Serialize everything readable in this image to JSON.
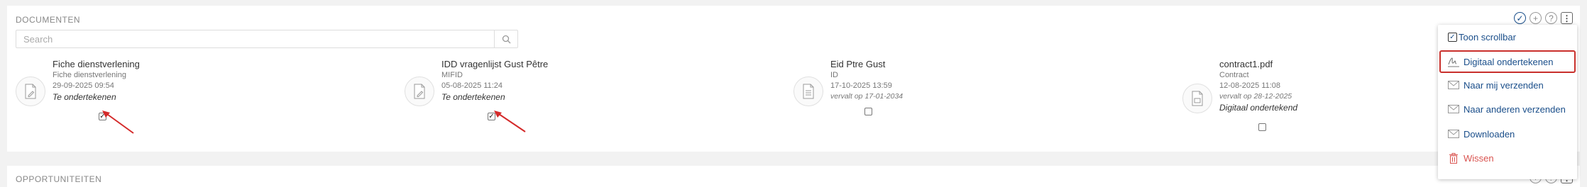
{
  "section": {
    "title": "DOCUMENTEN"
  },
  "section2": {
    "title": "OPPORTUNITEITEN"
  },
  "search": {
    "placeholder": "Search",
    "value": ""
  },
  "documents": [
    {
      "name": "Fiche dienstverlening",
      "type": "Fiche dienstverlening",
      "date": "29-09-2025 09:54",
      "status": "Te ondertekenen",
      "checked": true
    },
    {
      "name": "IDD vragenlijst Gust Pêtre",
      "type": "MIFID",
      "date": "05-08-2025 11:24",
      "status": "Te ondertekenen",
      "checked": true
    },
    {
      "name": "Eid Ptre Gust",
      "type": "ID",
      "date": "17-10-2025 13:59",
      "expiry": "vervalt op 17-01-2034",
      "checked": false
    },
    {
      "name": "contract1.pdf",
      "type": "Contract",
      "date": "12-08-2025 11:08",
      "expiry": "vervalt op 28-12-2025",
      "status": "Digitaal ondertekend",
      "checked": false
    }
  ],
  "menu": {
    "toggle_label": "Toon scrollbar",
    "items": [
      {
        "label": "Digitaal ondertekenen",
        "icon": "signature-icon"
      },
      {
        "label": "Naar mij verzenden",
        "icon": "envelope-icon"
      },
      {
        "label": "Naar anderen verzenden",
        "icon": "envelope-icon"
      },
      {
        "label": "Downloaden",
        "icon": "envelope-icon"
      },
      {
        "label": "Wissen",
        "icon": "trash-icon"
      }
    ]
  },
  "colors": {
    "accent": "#1a4e8a",
    "danger": "#d9534f",
    "annotation": "#d42a2a",
    "highlight_border": "#c9302c"
  }
}
